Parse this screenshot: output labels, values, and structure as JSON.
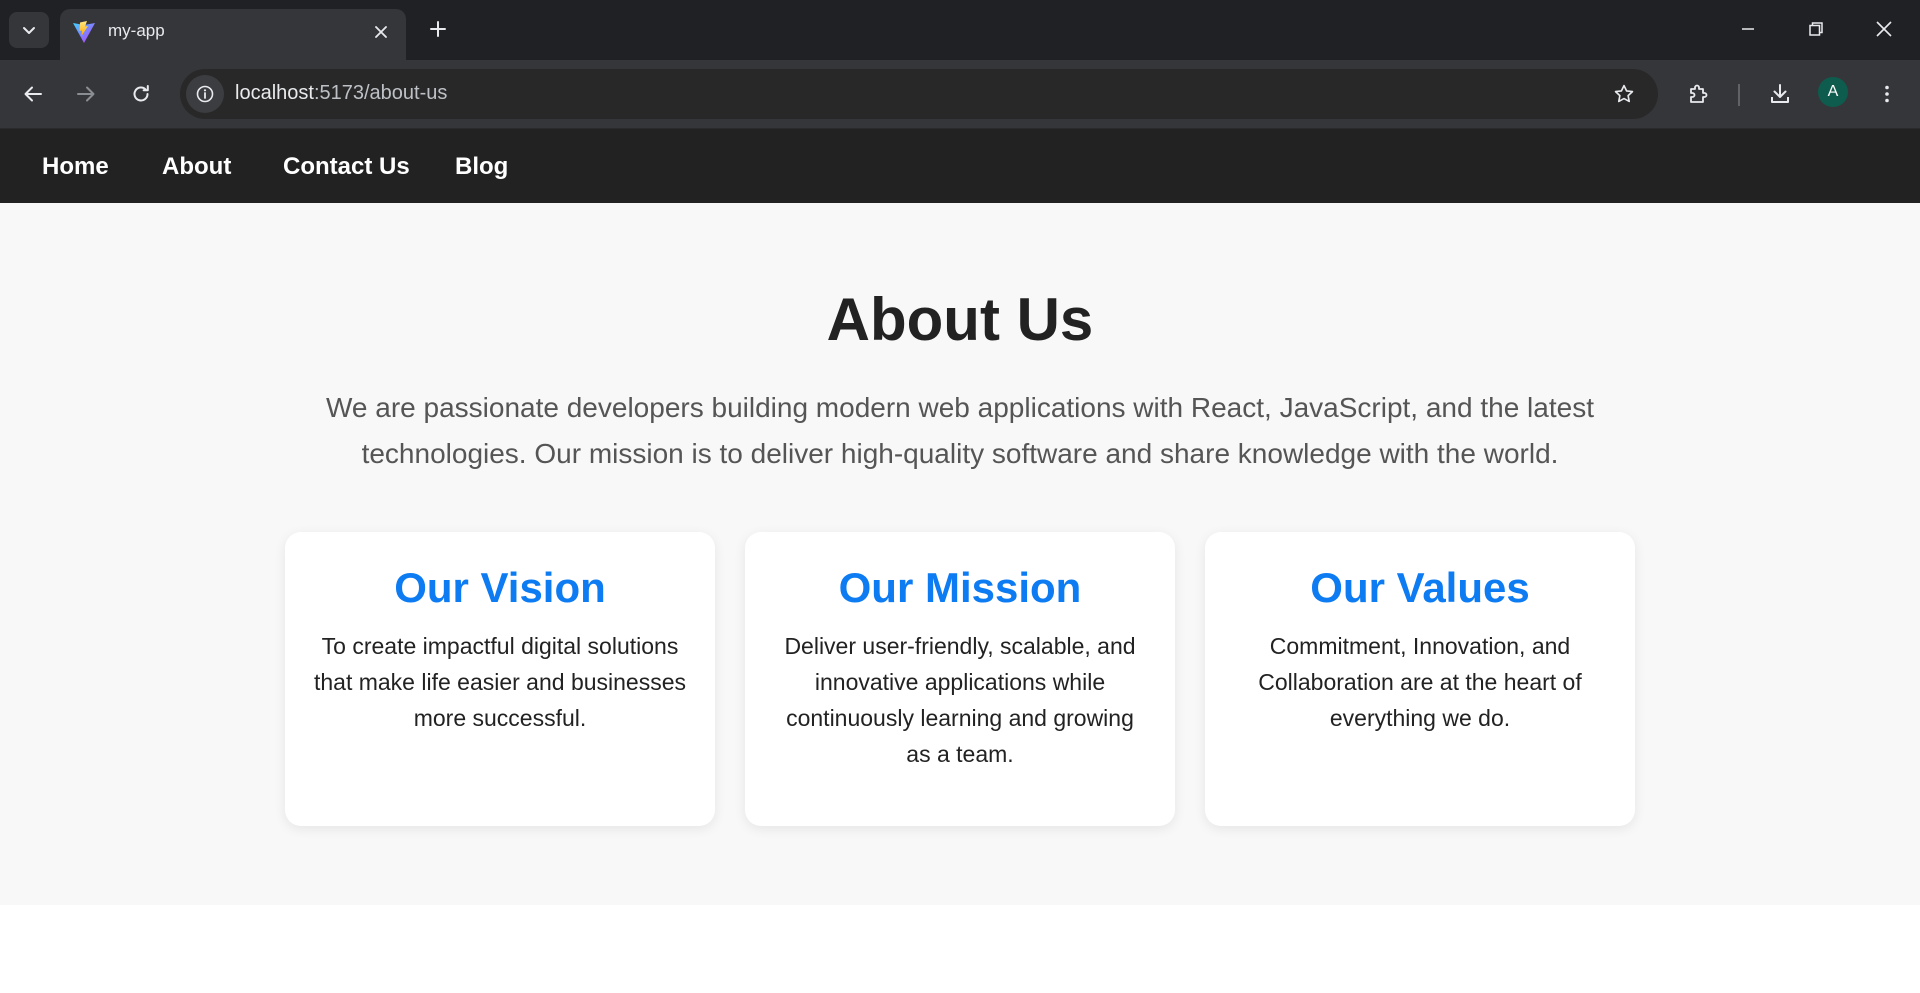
{
  "browser": {
    "tab": {
      "title": "my-app"
    },
    "url": {
      "host": "localhost",
      "path": ":5173/about-us"
    },
    "profile": {
      "initial": "A",
      "color": "#0e5c4d"
    }
  },
  "nav": {
    "links": [
      {
        "label": "Home"
      },
      {
        "label": "About"
      },
      {
        "label": "Contact Us"
      },
      {
        "label": "Blog"
      }
    ]
  },
  "about": {
    "title": "About Us",
    "intro": "We are passionate developers building modern web applications with React, JavaScript, and the latest technologies. Our mission is to deliver high-quality software and share knowledge with the world.",
    "cards": [
      {
        "title": "Our Vision",
        "text": "To create impactful digital solutions that make life easier and businesses more successful."
      },
      {
        "title": "Our Mission",
        "text": "Deliver user-friendly, scalable, and innovative applications while continuously learning and growing as a team."
      },
      {
        "title": "Our Values",
        "text": "Commitment, Innovation, and Collaboration are at the heart of everything we do."
      }
    ]
  },
  "colors": {
    "accent": "#0d7bf2",
    "nav_bg": "#222222",
    "section_bg": "#f8f8f8",
    "heading": "#222222",
    "body_text": "#555555"
  }
}
